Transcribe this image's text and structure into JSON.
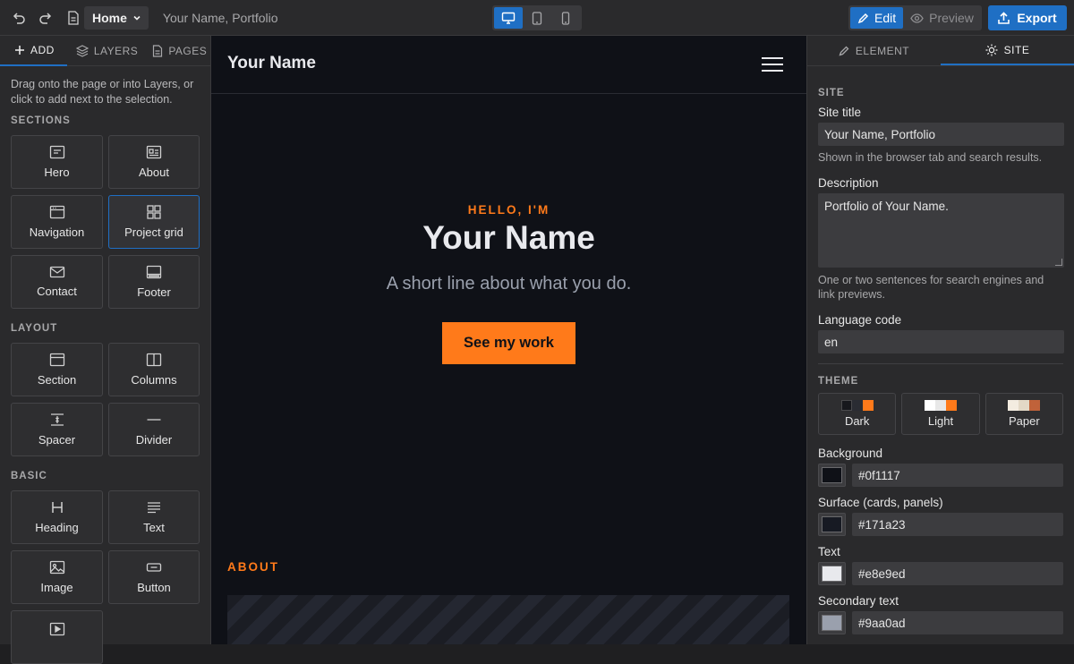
{
  "toolbar": {
    "page_select": "Home",
    "site_name": "Your Name, Portfolio",
    "edit_label": "Edit",
    "preview_label": "Preview",
    "export_label": "Export",
    "device_active": "desktop"
  },
  "left_panel": {
    "tabs": [
      {
        "label": "ADD",
        "icon": "plus-icon",
        "active": true
      },
      {
        "label": "LAYERS",
        "icon": "layers-icon",
        "active": false
      },
      {
        "label": "PAGES",
        "icon": "page-icon",
        "active": false
      }
    ],
    "hint": "Drag onto the page or into Layers, or click to add next to the selection.",
    "groups": [
      {
        "label": "SECTIONS",
        "items": [
          {
            "label": "Hero",
            "icon": "hero-icon"
          },
          {
            "label": "About",
            "icon": "about-icon"
          },
          {
            "label": "Navigation",
            "icon": "navigation-icon"
          },
          {
            "label": "Project grid",
            "icon": "grid-icon",
            "selected": true
          },
          {
            "label": "Contact",
            "icon": "mail-icon"
          },
          {
            "label": "Footer",
            "icon": "footer-icon"
          }
        ]
      },
      {
        "label": "LAYOUT",
        "items": [
          {
            "label": "Section",
            "icon": "section-icon"
          },
          {
            "label": "Columns",
            "icon": "columns-icon"
          },
          {
            "label": "Spacer",
            "icon": "spacer-icon"
          },
          {
            "label": "Divider",
            "icon": "divider-icon"
          }
        ]
      },
      {
        "label": "BASIC",
        "items": [
          {
            "label": "Heading",
            "icon": "heading-icon"
          },
          {
            "label": "Text",
            "icon": "text-icon"
          },
          {
            "label": "Image",
            "icon": "image-icon"
          },
          {
            "label": "Button",
            "icon": "button-icon"
          },
          {
            "label": "",
            "icon": "video-icon"
          }
        ]
      }
    ]
  },
  "canvas": {
    "brand": "Your Name",
    "hero_kicker": "HELLO, I'M",
    "hero_title": "Your Name",
    "hero_subtitle": "A short line about what you do.",
    "hero_cta": "See my work",
    "about_kicker": "ABOUT"
  },
  "right_panel": {
    "tabs": [
      {
        "label": "ELEMENT",
        "icon": "pencil-icon",
        "active": false
      },
      {
        "label": "SITE",
        "icon": "sun-icon",
        "active": true
      }
    ],
    "site_heading": "SITE",
    "site_title_label": "Site title",
    "site_title_value": "Your Name, Portfolio",
    "site_title_help": "Shown in the browser tab and search results.",
    "description_label": "Description",
    "description_value": "Portfolio of Your Name.",
    "description_help": "One or two sentences for search engines and link previews.",
    "language_label": "Language code",
    "language_value": "en",
    "theme_heading": "THEME",
    "themes": [
      {
        "label": "Dark",
        "swatches": [
          "#17181d",
          "#2a2c33",
          "#ff7a1a"
        ]
      },
      {
        "label": "Light",
        "swatches": [
          "#ffffff",
          "#e8e8e8",
          "#ff7a1a"
        ]
      },
      {
        "label": "Paper",
        "swatches": [
          "#f3ece0",
          "#e3d8c6",
          "#c0623a"
        ]
      }
    ],
    "colors": [
      {
        "label": "Background",
        "value": "#0f1117"
      },
      {
        "label": "Surface (cards, panels)",
        "value": "#171a23"
      },
      {
        "label": "Text",
        "value": "#e8e9ed"
      },
      {
        "label": "Secondary text",
        "value": "#9aa0ad"
      }
    ]
  }
}
